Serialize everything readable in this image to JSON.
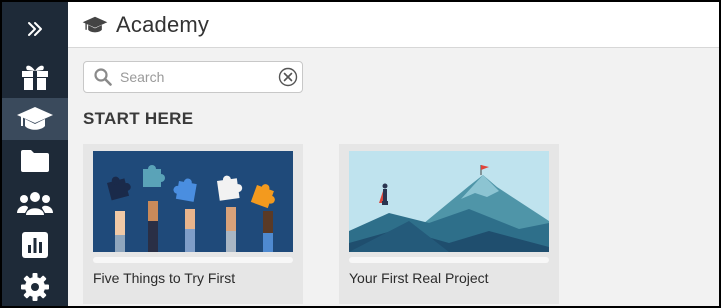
{
  "header": {
    "title": "Academy"
  },
  "sidebar": {
    "items": [
      {
        "icon": "chevrons-right-icon"
      },
      {
        "icon": "gift-icon"
      },
      {
        "icon": "graduation-cap-icon",
        "active": true
      },
      {
        "icon": "folder-icon"
      },
      {
        "icon": "users-icon"
      },
      {
        "icon": "bar-chart-icon"
      },
      {
        "icon": "gear-icon"
      }
    ]
  },
  "search": {
    "placeholder": "Search",
    "value": ""
  },
  "section": {
    "title": "START HERE"
  },
  "cards": [
    {
      "title": "Five Things to Try First",
      "image": "puzzle-hands-illustration"
    },
    {
      "title": "Your First Real Project",
      "image": "mountain-flag-illustration"
    }
  ],
  "colors": {
    "sidebar": "#1e2a38",
    "sidebar_active": "#3a4a5c",
    "background": "#f2f2f2",
    "card": "#e6e6e6",
    "thumb_navy": "#1f4a7a",
    "thumb_sky": "#bfe3ee"
  }
}
